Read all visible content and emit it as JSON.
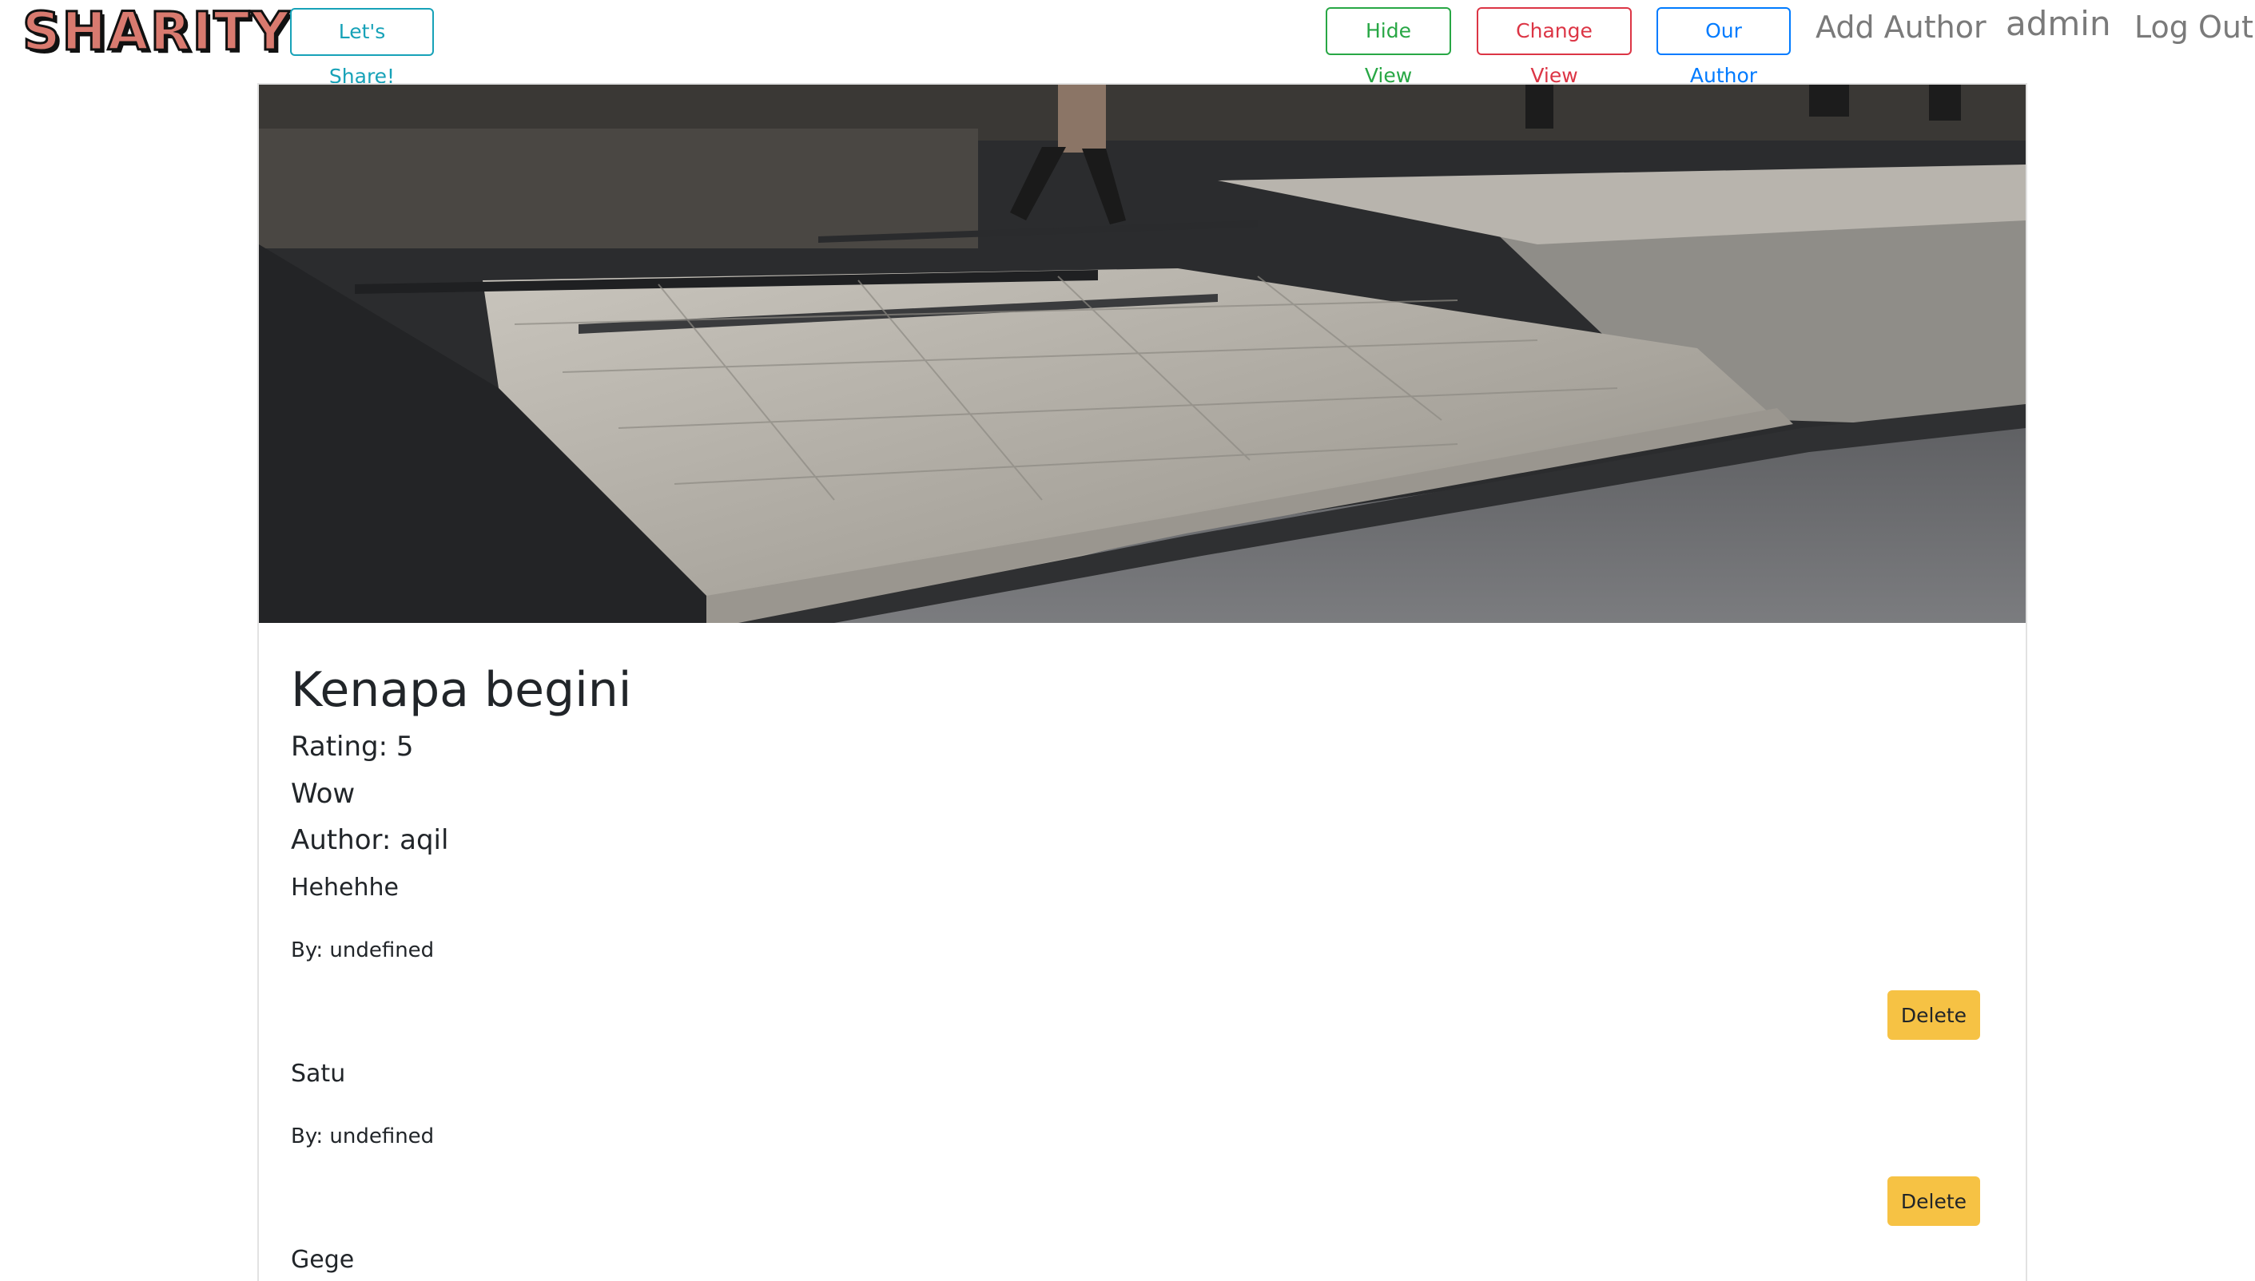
{
  "navbar": {
    "brand": "SHARITY",
    "share_button": "Let's Share!",
    "hide_view_button": "Hide View",
    "change_view_button": "Change View",
    "our_author_button": "Our Author",
    "add_author_link": "Add Author",
    "user_link": "admin",
    "logout_link": "Log Out"
  },
  "post": {
    "title": "Kenapa begini",
    "rating": "Rating: 5",
    "description": "Wow",
    "author": "Author: aqil",
    "comments": [
      {
        "text": "Hehehhe",
        "by": "By: undefined",
        "delete_label": "Delete"
      },
      {
        "text": "Satu",
        "by": "By: undefined",
        "delete_label": "Delete"
      },
      {
        "text": "Gege"
      }
    ]
  },
  "colors": {
    "info": "#17a2b8",
    "success": "#28a745",
    "danger": "#dc3545",
    "primary": "#007bff",
    "warning": "#f6c244"
  }
}
